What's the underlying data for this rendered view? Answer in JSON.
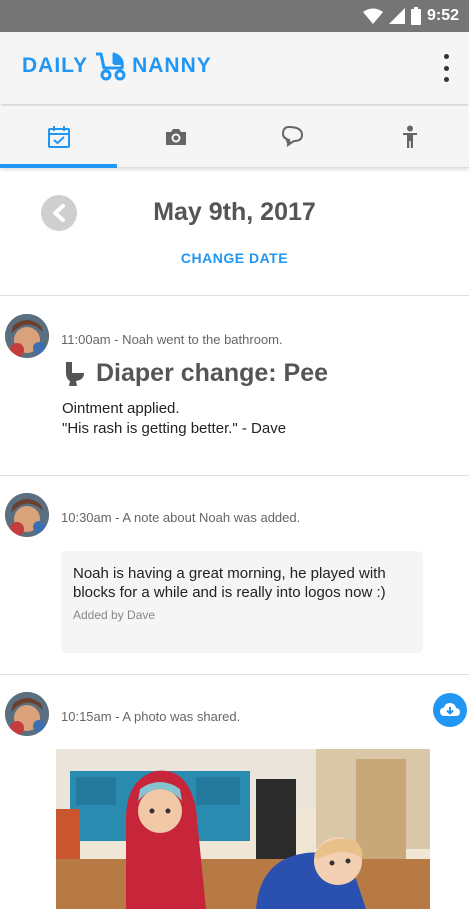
{
  "status_bar": {
    "time": "9:52"
  },
  "app": {
    "logo_left": "DAILY",
    "logo_right": "NANNY",
    "brand_color": "#2196f3"
  },
  "tabs": [
    {
      "icon": "calendar-icon",
      "active": true
    },
    {
      "icon": "camera-icon",
      "active": false
    },
    {
      "icon": "chat-bubbles-icon",
      "active": false
    },
    {
      "icon": "child-icon",
      "active": false
    }
  ],
  "date": {
    "title": "May 9th, 2017",
    "change_label": "CHANGE DATE"
  },
  "entries": [
    {
      "meta": "11:00am - Noah went to the bathroom.",
      "title": "Diaper change: Pee",
      "line1": "Ointment applied.",
      "line2": "\"His rash is getting better.\" - Dave"
    },
    {
      "meta": "10:30am - A note about Noah was added.",
      "note": "Noah is having a great morning, he played with blocks for a while and is really into logos now :)",
      "added_by": "Added by Dave"
    },
    {
      "meta": "10:15am - A photo was shared."
    }
  ]
}
